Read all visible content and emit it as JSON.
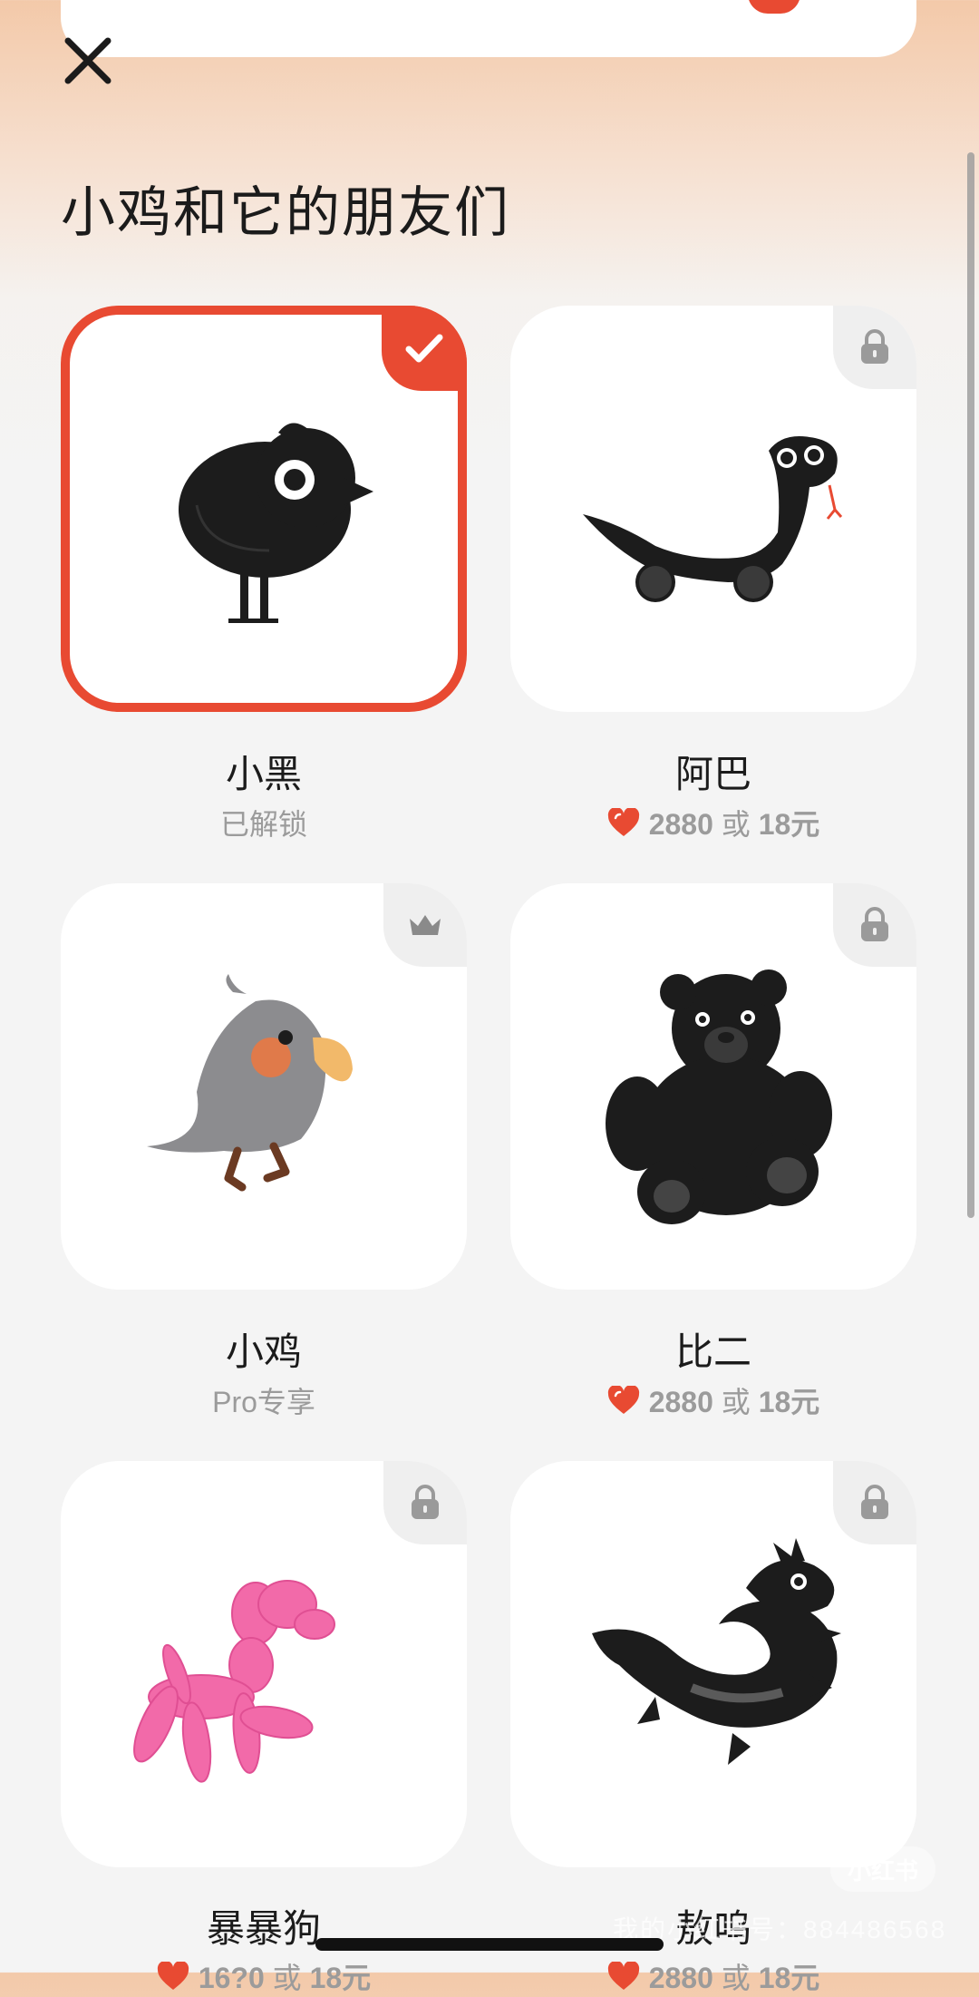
{
  "page": {
    "title": "小鸡和它的朋友们"
  },
  "icons": {
    "close": "close-icon",
    "check": "check-icon",
    "lock": "lock-icon",
    "crown": "crown-icon",
    "heart": "heart-icon"
  },
  "colors": {
    "accent": "#e84a32",
    "muted": "#9b9b9b",
    "card": "#ffffff"
  },
  "characters": [
    {
      "name": "小黑",
      "status": "已解锁",
      "badge": "check",
      "selected": true
    },
    {
      "name": "阿巴",
      "price_hearts": "2880",
      "or_text": "或",
      "price_money": "18元",
      "badge": "lock"
    },
    {
      "name": "小鸡",
      "status": "Pro专享",
      "badge": "crown"
    },
    {
      "name": "比二",
      "price_hearts": "2880",
      "or_text": "或",
      "price_money": "18元",
      "badge": "lock"
    },
    {
      "name": "暴暴狗",
      "price_hearts": "16?0",
      "or_text": "或",
      "price_money": "18元",
      "badge": "lock"
    },
    {
      "name": "敖呜",
      "price_hearts": "2880",
      "or_text": "或",
      "price_money": "18元",
      "badge": "lock"
    }
  ],
  "watermark": {
    "logo": "小红书",
    "text": "我的小红书号：884486568"
  }
}
